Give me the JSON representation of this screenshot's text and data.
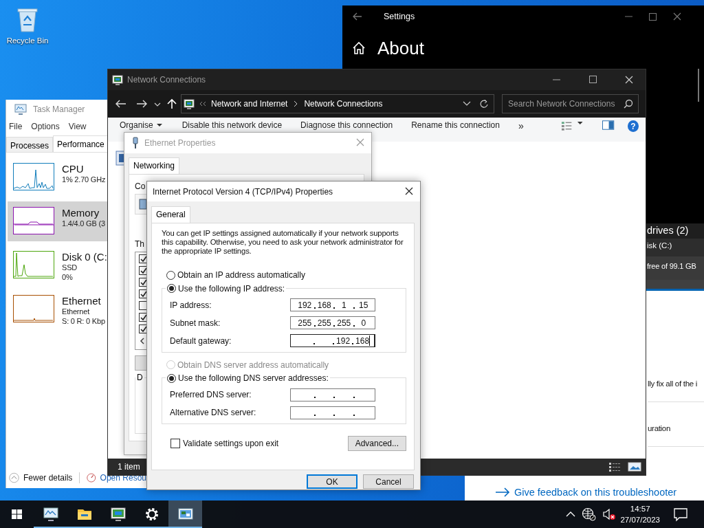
{
  "desktop": {
    "icons": [
      {
        "label": "Recycle Bin",
        "kind": "recycle-bin"
      }
    ]
  },
  "settings_window": {
    "title": "Settings",
    "heading": "About",
    "lines": [
      {
        "text": "drives (2)",
        "kind": "heading"
      },
      {
        "text": "isk (C:)",
        "kind": "item"
      },
      {
        "text": "free of 99.1 GB",
        "kind": "detail"
      }
    ]
  },
  "troubleshooter_window": {
    "lines": [
      "lly fix all of the i",
      "uration"
    ],
    "link": "Give feedback on this troubleshooter"
  },
  "task_manager": {
    "title": "Task Manager",
    "menu": [
      "File",
      "Options",
      "View"
    ],
    "tabs": [
      {
        "label": "Processes",
        "selected": false
      },
      {
        "label": "Performance",
        "selected": true
      }
    ],
    "resources": [
      {
        "kind": "cpu",
        "name": "CPU",
        "lines": [
          "1% 2.70 GHz"
        ],
        "color": "#117dbb",
        "selected": false
      },
      {
        "kind": "memory",
        "name": "Memory",
        "lines": [
          "1.4/4.0 GB (3"
        ],
        "color": "#8b12ae",
        "selected": true
      },
      {
        "kind": "disk",
        "name": "Disk 0 (C:",
        "lines": [
          "SSD",
          "0%"
        ],
        "color": "#4da60c",
        "selected": false
      },
      {
        "kind": "network",
        "name": "Ethernet",
        "lines": [
          "Ethernet",
          "S: 0 R: 0 Kbp"
        ],
        "color": "#a74f01",
        "selected": false
      }
    ],
    "footer": {
      "toggle": "Fewer details",
      "link": "Open Resou"
    }
  },
  "network_connections": {
    "title": "Network Connections",
    "breadcrumb": [
      "Network and Internet",
      "Network Connections"
    ],
    "search_placeholder": "Search Network Connections",
    "toolbar": [
      {
        "label": "Organise",
        "kind": "menu"
      },
      {
        "label": "Disable this network device",
        "kind": "command"
      },
      {
        "label": "Diagnose this connection",
        "kind": "command"
      },
      {
        "label": "Rename this connection",
        "kind": "command"
      },
      {
        "label": "»",
        "kind": "overflow"
      }
    ],
    "help": "?",
    "status": "1 item"
  },
  "ethernet_properties": {
    "title": "Ethernet Properties",
    "tabs": [
      {
        "label": "Networking",
        "selected": true
      }
    ],
    "labels": [
      "Co",
      "Th",
      "D"
    ],
    "components": [
      {
        "checked": true
      },
      {
        "checked": true
      },
      {
        "checked": true
      },
      {
        "checked": true
      },
      {
        "checked": false
      },
      {
        "checked": true
      },
      {
        "checked": true
      }
    ]
  },
  "ipv4_dialog": {
    "title": "Internet Protocol Version 4 (TCP/IPv4) Properties",
    "tabs": [
      {
        "label": "General",
        "selected": true
      }
    ],
    "intro": "You can get IP settings assigned automatically if your network supports this capability. Otherwise, you need to ask your network administrator for the appropriate IP settings.",
    "ip_mode": [
      {
        "label": "Obtain an IP address automatically",
        "selected": false,
        "disabled": false
      },
      {
        "label": "Use the following IP address:",
        "selected": true,
        "disabled": false
      }
    ],
    "ip_fields": [
      {
        "label": "IP address:",
        "octets": [
          "192",
          "168",
          "1",
          "15"
        ],
        "focused": false
      },
      {
        "label": "Subnet mask:",
        "octets": [
          "255",
          "255",
          "255",
          "0"
        ],
        "focused": false
      },
      {
        "label": "Default gateway:",
        "octets": [
          "192",
          "168"
        ],
        "focused": true
      }
    ],
    "dns_mode": [
      {
        "label": "Obtain DNS server address automatically",
        "selected": false,
        "disabled": true
      },
      {
        "label": "Use the following DNS server addresses:",
        "selected": true,
        "disabled": false
      }
    ],
    "dns_fields": [
      {
        "label": "Preferred DNS server:",
        "focused": false
      },
      {
        "label": "Alternative DNS server:",
        "focused": false
      }
    ],
    "validate": {
      "label": "Validate settings upon exit",
      "checked": false
    },
    "advanced": {
      "label": "Advanced..."
    },
    "buttons": [
      {
        "label": "OK",
        "default": true
      },
      {
        "label": "Cancel",
        "default": false
      }
    ]
  },
  "taskbar": {
    "apps": [
      {
        "kind": "task-manager",
        "running": true,
        "active": false
      },
      {
        "kind": "file-explorer",
        "running": true,
        "active": false
      },
      {
        "kind": "control-panel",
        "running": true,
        "active": false
      },
      {
        "kind": "settings",
        "running": true,
        "active": false
      },
      {
        "kind": "network-connections",
        "running": true,
        "active": true
      }
    ],
    "time": "14:57",
    "date": "27/07/2023"
  }
}
